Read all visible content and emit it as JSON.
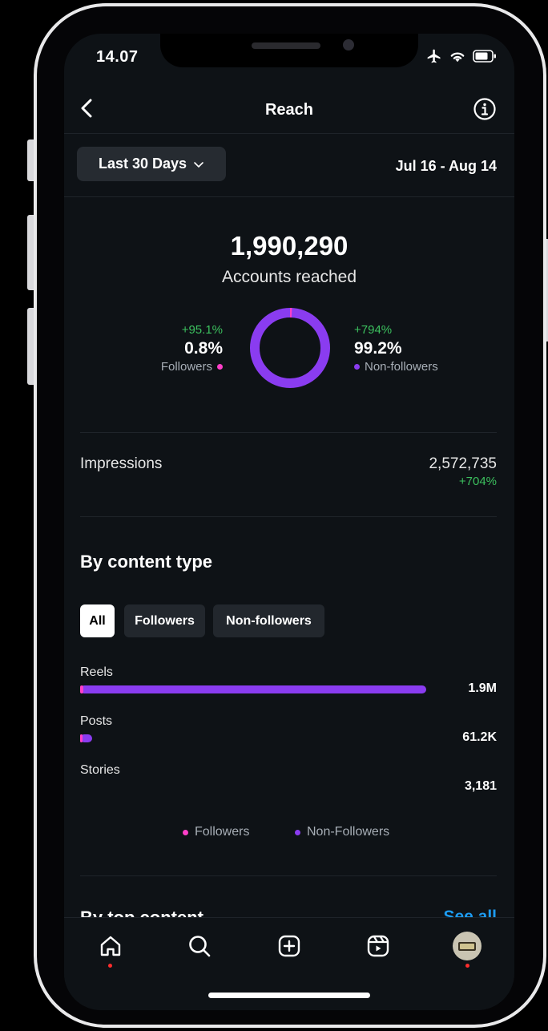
{
  "status_bar": {
    "time": "14.07"
  },
  "header": {
    "title": "Reach"
  },
  "filter": {
    "period_label": "Last 30 Days",
    "date_range": "Jul 16 - Aug 14"
  },
  "summary": {
    "accounts_reached": "1,990,290",
    "accounts_label": "Accounts reached",
    "followers": {
      "delta": "+95.1%",
      "percent": "0.8%",
      "label": "Followers",
      "share": 0.008
    },
    "non_followers": {
      "delta": "+794%",
      "percent": "99.2%",
      "label": "Non-followers",
      "share": 0.992
    }
  },
  "impressions": {
    "label": "Impressions",
    "value": "2,572,735",
    "delta": "+704%"
  },
  "content_type": {
    "title": "By content type",
    "chips": [
      {
        "label": "All",
        "active": true
      },
      {
        "label": "Followers",
        "active": false
      },
      {
        "label": "Non-followers",
        "active": false
      }
    ],
    "rows": [
      {
        "label": "Reels",
        "value": "1.9M"
      },
      {
        "label": "Posts",
        "value": "61.2K"
      },
      {
        "label": "Stories",
        "value": "3,181"
      }
    ],
    "legend": {
      "followers": "Followers",
      "non_followers": "Non-Followers"
    }
  },
  "top_content": {
    "title": "By top content",
    "see_all": "See all"
  },
  "colors": {
    "followers": "#ff3fc8",
    "non_followers": "#8a3cf0",
    "positive": "#3cc05e",
    "link": "#1d9bf0"
  },
  "icons": [
    "back-icon",
    "info-icon",
    "chevron-down-icon",
    "airplane-icon",
    "wifi-icon",
    "battery-icon",
    "home-icon",
    "search-icon",
    "create-icon",
    "reels-icon",
    "avatar"
  ]
}
